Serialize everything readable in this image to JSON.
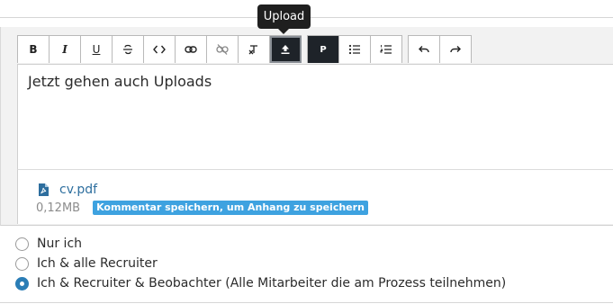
{
  "tooltip": {
    "text": "Upload"
  },
  "toolbar": {
    "groups": [
      [
        {
          "name": "bold-button",
          "icon": "bold-icon",
          "label": "B"
        },
        {
          "name": "italic-button",
          "icon": "italic-icon",
          "label": "I"
        },
        {
          "name": "underline-button",
          "icon": "underline-icon",
          "label": "U"
        },
        {
          "name": "strikethrough-button",
          "icon": "strikethrough-icon"
        },
        {
          "name": "code-button",
          "icon": "code-icon"
        },
        {
          "name": "link-button",
          "icon": "link-icon"
        },
        {
          "name": "unlink-button",
          "icon": "unlink-icon"
        },
        {
          "name": "clear-format-button",
          "icon": "clear-format-icon"
        },
        {
          "name": "upload-button",
          "icon": "upload-icon",
          "state": "focused"
        }
      ],
      [
        {
          "name": "paragraph-button",
          "icon": "paragraph-icon",
          "label": "P",
          "state": "active"
        },
        {
          "name": "bullet-list-button",
          "icon": "bullet-list-icon"
        },
        {
          "name": "ordered-list-button",
          "icon": "ordered-list-icon"
        }
      ],
      [
        {
          "name": "undo-button",
          "icon": "undo-icon"
        },
        {
          "name": "redo-button",
          "icon": "redo-icon"
        }
      ]
    ]
  },
  "editor": {
    "content": "Jetzt gehen auch Uploads"
  },
  "attachment": {
    "icon": "pdf-file-icon",
    "file_name": "cv.pdf",
    "file_size": "0,12MB",
    "note": "Kommentar speichern, um Anhang zu speichern"
  },
  "visibility": {
    "options": [
      {
        "label": "Nur ich",
        "checked": false
      },
      {
        "label": "Ich & alle Recruiter",
        "checked": false
      },
      {
        "label": "Ich & Recruiter & Beobachter (Alle Mitarbeiter die am Prozess teilnehmen)",
        "checked": true
      }
    ]
  },
  "colors": {
    "accent": "#2a7db6",
    "badge": "#3ea2e0",
    "active_button": "#1e2329",
    "link": "#2d6e9e"
  }
}
